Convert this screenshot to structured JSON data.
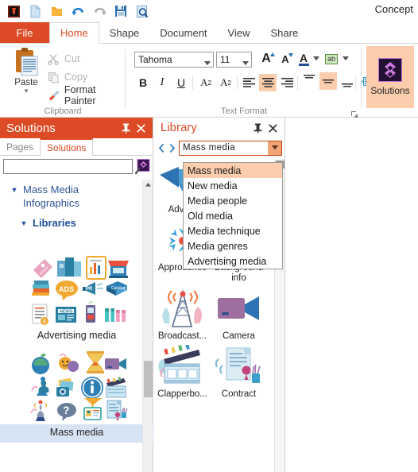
{
  "window": {
    "title": "Concept"
  },
  "quick_access": {
    "items": [
      {
        "name": "app-icon",
        "icon": "app-icon"
      },
      {
        "name": "new-document-button",
        "icon": "page-icon",
        "label": "New"
      },
      {
        "name": "open-folder-button",
        "icon": "folder-icon",
        "label": "Open"
      },
      {
        "name": "undo-button",
        "icon": "undo-arrow-icon",
        "label": "Undo"
      },
      {
        "name": "redo-button",
        "icon": "redo-arrow-icon",
        "label": "Redo"
      },
      {
        "name": "save-button",
        "icon": "floppy-disk-icon",
        "label": "Save"
      },
      {
        "name": "preview-button",
        "icon": "magnifier-page-icon",
        "label": "Print Preview"
      }
    ]
  },
  "ribbon": {
    "file_tab": "File",
    "tabs": [
      {
        "label": "Home",
        "active": true
      },
      {
        "label": "Shape",
        "active": false
      },
      {
        "label": "Document",
        "active": false
      },
      {
        "label": "View",
        "active": false
      },
      {
        "label": "Share",
        "active": false
      }
    ],
    "clipboard": {
      "group_label": "Clipboard",
      "paste_label": "Paste",
      "cut_label": "Cut",
      "copy_label": "Copy",
      "format_painter_label": "Format Painter"
    },
    "text_format": {
      "group_label": "Text Format",
      "font_family": "Tahoma",
      "font_size": "11",
      "grow_font_label": "A",
      "shrink_font_label": "A",
      "font_color_label": "A",
      "highlight_label": "ab",
      "bold_label": "B",
      "italic_label": "I",
      "underline_label": "U",
      "superscript_label": "A",
      "superscript_sup": "2",
      "subscript_label": "A",
      "subscript_sub": "2"
    },
    "solutions": {
      "label": "Solutions"
    }
  },
  "left_panel": {
    "title": "Solutions",
    "pin_icon": "pin-icon",
    "close_icon": "close-icon",
    "tabs": [
      {
        "label": "Pages",
        "active": false
      },
      {
        "label": "Solutions",
        "active": true
      }
    ],
    "search": {
      "value": "",
      "placeholder": "",
      "button_icon": "search-solutions-icon"
    },
    "tree": [
      {
        "label": "Mass Media Infographics",
        "bold": false,
        "expanded": true,
        "indent": 0
      },
      {
        "label": "Libraries",
        "bold": true,
        "expanded": true,
        "indent": 1
      }
    ],
    "thumbnails": [
      {
        "caption": "Advertising media",
        "selected": false
      },
      {
        "caption": "Mass media",
        "selected": true
      }
    ]
  },
  "right_panel": {
    "title": "Library",
    "pin_icon": "pin-icon",
    "close_icon": "close-icon",
    "prev_icon": "chevron-left-icon",
    "next_icon": "chevron-right-icon",
    "combo": {
      "value": "Mass media",
      "arrow_icon": "chevron-down-icon",
      "expanded": true,
      "options": [
        {
          "label": "Mass media",
          "selected": true
        },
        {
          "label": "New media",
          "selected": false
        },
        {
          "label": "Media people",
          "selected": false
        },
        {
          "label": "Old media",
          "selected": false
        },
        {
          "label": "Media technique",
          "selected": false
        },
        {
          "label": "Media genres",
          "selected": false
        },
        {
          "label": "Advertising media",
          "selected": false
        }
      ]
    },
    "shapes": [
      {
        "caption": "Adve...",
        "icon": "arrow-shape-icon"
      },
      {
        "caption": "",
        "icon": "blank-icon"
      },
      {
        "caption": "Approaches",
        "icon": "approaches-arrows-icon"
      },
      {
        "caption": "Background info",
        "icon": "background-info-icon"
      },
      {
        "caption": "Broadcast...",
        "icon": "broadcast-tower-icon"
      },
      {
        "caption": "Camera",
        "icon": "video-camera-icon"
      },
      {
        "caption": "Clapperbo...",
        "icon": "clapperboard-icon"
      },
      {
        "caption": "Contract",
        "icon": "contract-document-icon"
      }
    ]
  }
}
